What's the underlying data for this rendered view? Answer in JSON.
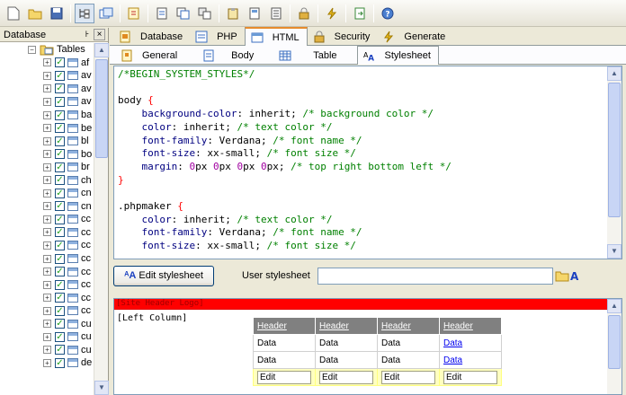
{
  "toolbar": {
    "icons": [
      "new-file-icon",
      "open-folder-icon",
      "save-icon",
      "tree-view-icon",
      "window-icon",
      "script-icon",
      "page-icon",
      "copy-icon",
      "multi-copy-icon",
      "paste-icon",
      "document-icon",
      "list-icon",
      "lock-icon",
      "generate-icon",
      "export-icon",
      "help-icon"
    ]
  },
  "left_panel": {
    "title": "Database",
    "pin": "꜔",
    "close": "×",
    "tables_label": "Tables",
    "items": [
      "af",
      "av",
      "av",
      "av",
      "ba",
      "be",
      "bl",
      "bo",
      "br",
      "ch",
      "cn",
      "cn",
      "cc",
      "cc",
      "cc",
      "cc",
      "cc",
      "cc",
      "cc",
      "cc",
      "cu",
      "cu",
      "cu",
      "de"
    ]
  },
  "main_tabs": [
    {
      "label": "Database",
      "icon": "database-icon"
    },
    {
      "label": "PHP",
      "icon": "php-icon"
    },
    {
      "label": "HTML",
      "icon": "html-icon",
      "active": true
    },
    {
      "label": "Security",
      "icon": "lock-icon"
    },
    {
      "label": "Generate",
      "icon": "lightning-icon"
    }
  ],
  "sub_tabs": [
    {
      "label": "General",
      "icon": "general-icon"
    },
    {
      "label": "Body",
      "icon": "page-icon"
    },
    {
      "label": "Table",
      "icon": "table-icon"
    },
    {
      "label": "Stylesheet",
      "icon": "stylesheet-icon",
      "active": true
    }
  ],
  "editor": {
    "lines": [
      "/*BEGIN_SYSTEM_STYLES*/",
      "",
      "body {",
      "    background-color: inherit; /* background color */",
      "    color: inherit; /* text color */",
      "    font-family: Verdana; /* font name */",
      "    font-size: xx-small; /* font size */",
      "    margin: 0px 0px 0px 0px; /* top right bottom left */",
      "}",
      "",
      ".phpmaker {",
      "    color: inherit; /* text color */",
      "    font-family: Verdana; /* font name */",
      "    font-size: xx-small; /* font size */"
    ]
  },
  "stylebar": {
    "edit_button": "Edit stylesheet",
    "user_stylesheet_label": "User stylesheet",
    "user_stylesheet_value": ""
  },
  "preview": {
    "header_text": "[Site Header Logo]",
    "left_column": "[Left Column]",
    "table_headers": [
      "Header",
      "Header",
      "Header",
      "Header"
    ],
    "rows": [
      [
        "Data",
        "Data",
        "Data",
        "Data"
      ],
      [
        "Data",
        "Data",
        "Data",
        "Data"
      ]
    ],
    "edit_row": [
      "Edit",
      "Edit",
      "Edit",
      "Edit"
    ]
  },
  "colors": {
    "accent_tab": "#e68b2c",
    "header_red": "#ff0000",
    "table_header_gray": "#808080",
    "edit_row_yellow": "#ffffc0"
  }
}
